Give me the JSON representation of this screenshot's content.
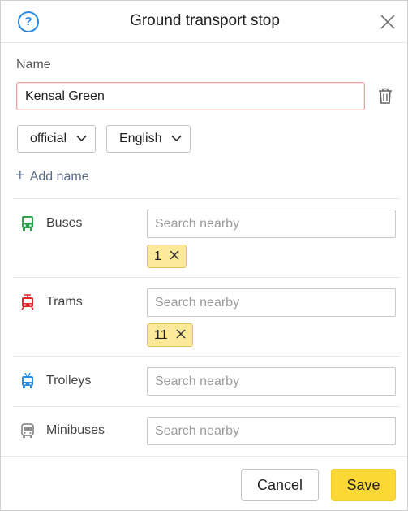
{
  "header": {
    "title": "Ground transport stop",
    "help_icon": "help-icon",
    "help_glyph": "?",
    "close_icon": "close-icon"
  },
  "name_section": {
    "label": "Name",
    "value": "Kensal Green",
    "delete_icon": "trash-icon",
    "type_select": "official",
    "language_select": "English",
    "add_name_label": "Add name"
  },
  "transports": [
    {
      "label": "Buses",
      "icon": "bus-icon",
      "icon_color": "#2ca34a",
      "placeholder": "Search nearby",
      "chips": [
        "1"
      ]
    },
    {
      "label": "Trams",
      "icon": "tram-icon",
      "icon_color": "#e8262a",
      "placeholder": "Search nearby",
      "chips": [
        "11"
      ]
    },
    {
      "label": "Trolleys",
      "icon": "trolleybus-icon",
      "icon_color": "#2b8ce0",
      "placeholder": "Search nearby",
      "chips": []
    },
    {
      "label": "Minibuses",
      "icon": "minibus-icon",
      "icon_color": "#8f8f8f",
      "placeholder": "Search nearby",
      "chips": []
    }
  ],
  "footer": {
    "cancel_label": "Cancel",
    "save_label": "Save"
  },
  "colors": {
    "accent": "#2b8ce0",
    "save_button": "#fcd837",
    "chip": "#fde99a"
  }
}
